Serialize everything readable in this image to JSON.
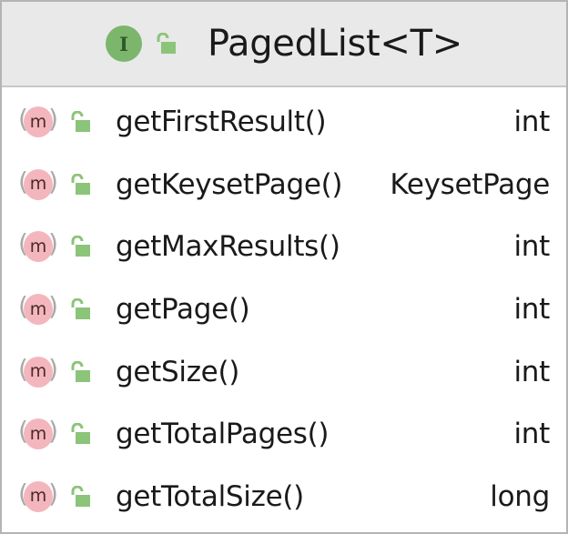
{
  "class": {
    "name": "PagedList<T>",
    "kind_icon_letter": "I",
    "kind_icon": "interface-icon",
    "visibility_icon": "unlocked-icon"
  },
  "members": [
    {
      "name": "getFirstResult()",
      "type": "int",
      "icon_letter": "m",
      "icon": "method-icon"
    },
    {
      "name": "getKeysetPage()",
      "type": "KeysetPage",
      "icon_letter": "m",
      "icon": "method-icon"
    },
    {
      "name": "getMaxResults()",
      "type": "int",
      "icon_letter": "m",
      "icon": "method-icon"
    },
    {
      "name": "getPage()",
      "type": "int",
      "icon_letter": "m",
      "icon": "method-icon"
    },
    {
      "name": "getSize()",
      "type": "int",
      "icon_letter": "m",
      "icon": "method-icon"
    },
    {
      "name": "getTotalPages()",
      "type": "int",
      "icon_letter": "m",
      "icon": "method-icon"
    },
    {
      "name": "getTotalSize()",
      "type": "long",
      "icon_letter": "m",
      "icon": "method-icon"
    }
  ],
  "colors": {
    "interface_badge": "#7cb66c",
    "method_badge": "#f4b6bd",
    "lock": "#8cc47a",
    "header_bg": "#e9e9e9",
    "border": "#b4b4b4"
  }
}
